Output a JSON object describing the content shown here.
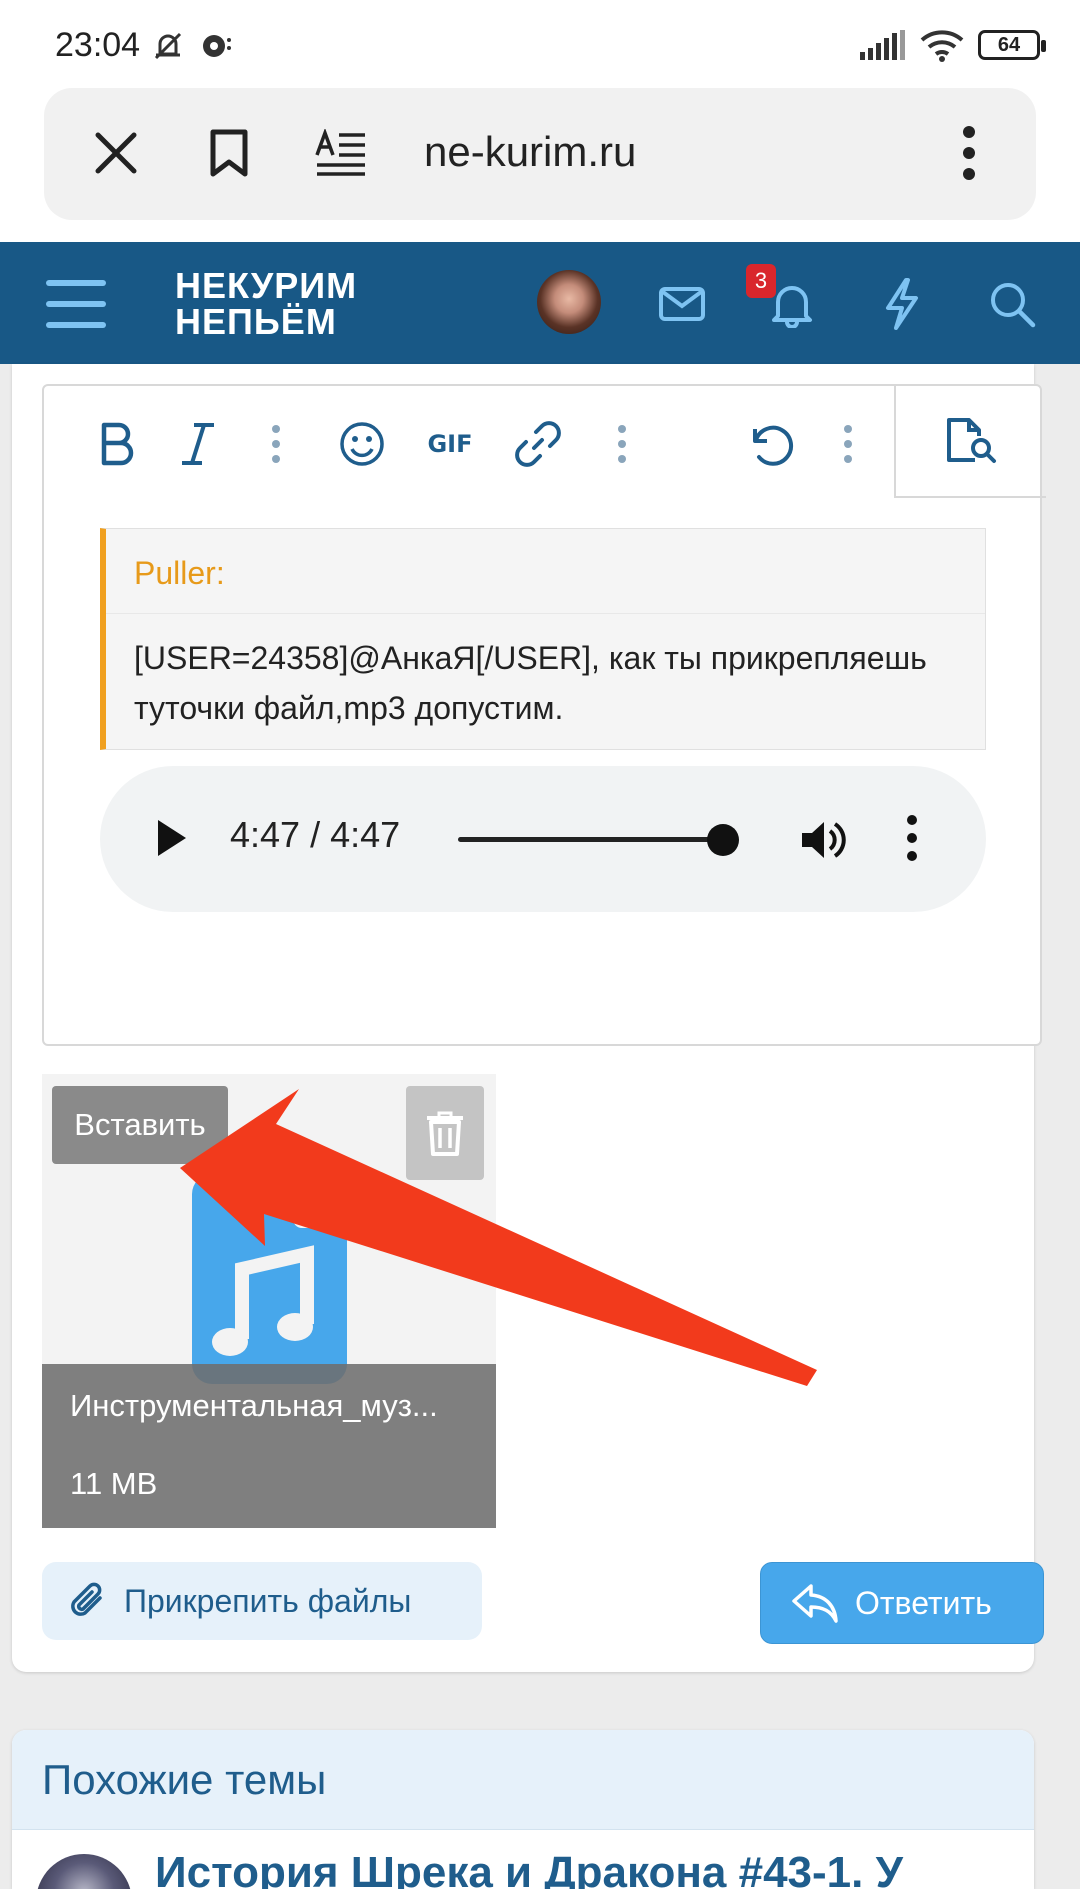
{
  "status": {
    "time": "23:04",
    "battery": "64"
  },
  "browser": {
    "url": "ne-kurim.ru"
  },
  "site": {
    "logo_line1": "НЕКУРИМ",
    "logo_line2": "НЕПЬЁМ",
    "notifications_count": "3"
  },
  "editor": {
    "toolbar": [
      "bold",
      "italic",
      "more",
      "emoji",
      "gif",
      "link",
      "more",
      "undo",
      "more",
      "preview"
    ],
    "gif_label": "GIF",
    "quote_author": "Puller:",
    "quote_text": "[USER=24358]@АнкаЯ[/USER], как ты прикрепляешь туточки файл,mp3 допустим.",
    "audio_time": "4:47 / 4:47",
    "audio_progress": 1.0
  },
  "attachment": {
    "insert_label": "Вставить",
    "file_name": "Инструментальная_муз...",
    "file_size": "11 MB"
  },
  "actions": {
    "attach_files_label": "Прикрепить файлы",
    "reply_label": "Ответить"
  },
  "similar": {
    "title": "Похожие темы",
    "thread_title": "История Шрека и Дракона #43-1. У"
  },
  "colors": {
    "header_bg": "#185886",
    "accent_blue": "#47a7eb",
    "quote_accent": "#f0a020",
    "arrow_red": "#f23a1c",
    "badge_red": "#d9262c"
  }
}
